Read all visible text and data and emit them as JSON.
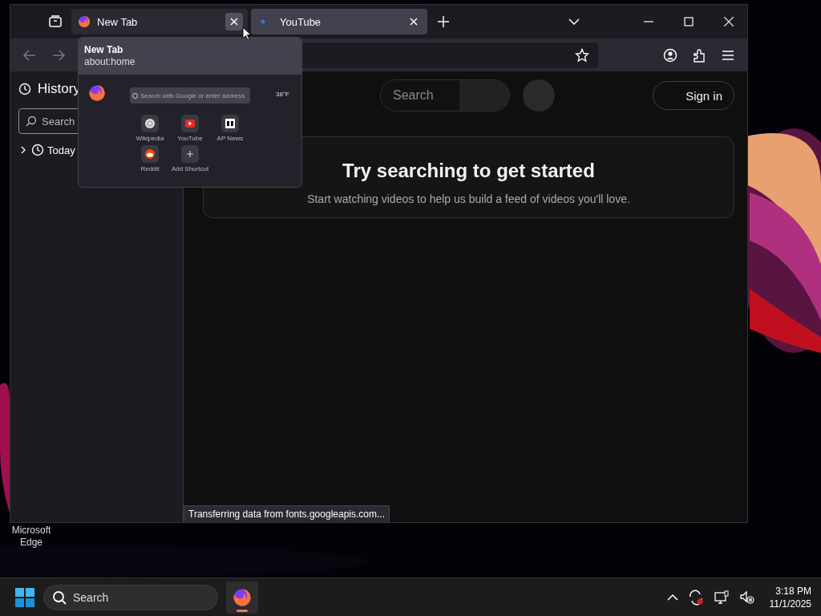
{
  "desktop": {
    "icon_label": "Microsoft Edge"
  },
  "browser": {
    "tabs": [
      {
        "title": "New Tab",
        "kind": "firefox",
        "selected": false,
        "hovered": true
      },
      {
        "title": "YouTube",
        "kind": "dot",
        "selected": true,
        "hovered": false
      }
    ],
    "sidebar": {
      "title": "History",
      "search_placeholder": "Search",
      "items": [
        {
          "label": "Today",
          "expanded": false
        }
      ]
    },
    "page": {
      "search_placeholder": "Search",
      "sign_in": "Sign in",
      "heading": "Try searching to get started",
      "subtext": "Start watching videos to help us build a feed of videos you'll love."
    },
    "status_bar": "Transferring data from fonts.googleapis.com...",
    "tab_preview": {
      "title": "New Tab",
      "url": "about:home",
      "thumbnail": {
        "search_placeholder": "Search with Google or enter address",
        "weather": "38°F",
        "shortcuts": [
          {
            "label": "Wikipedia",
            "kind": "wiki"
          },
          {
            "label": "YouTube",
            "kind": "youtube"
          },
          {
            "label": "AP News",
            "kind": "ap"
          },
          {
            "label": "Reddit",
            "kind": "reddit"
          },
          {
            "label": "Add Shortcut",
            "kind": "add"
          }
        ]
      }
    }
  },
  "taskbar": {
    "search_placeholder": "Search",
    "time": "3:18 PM",
    "date": "11/1/2025"
  }
}
